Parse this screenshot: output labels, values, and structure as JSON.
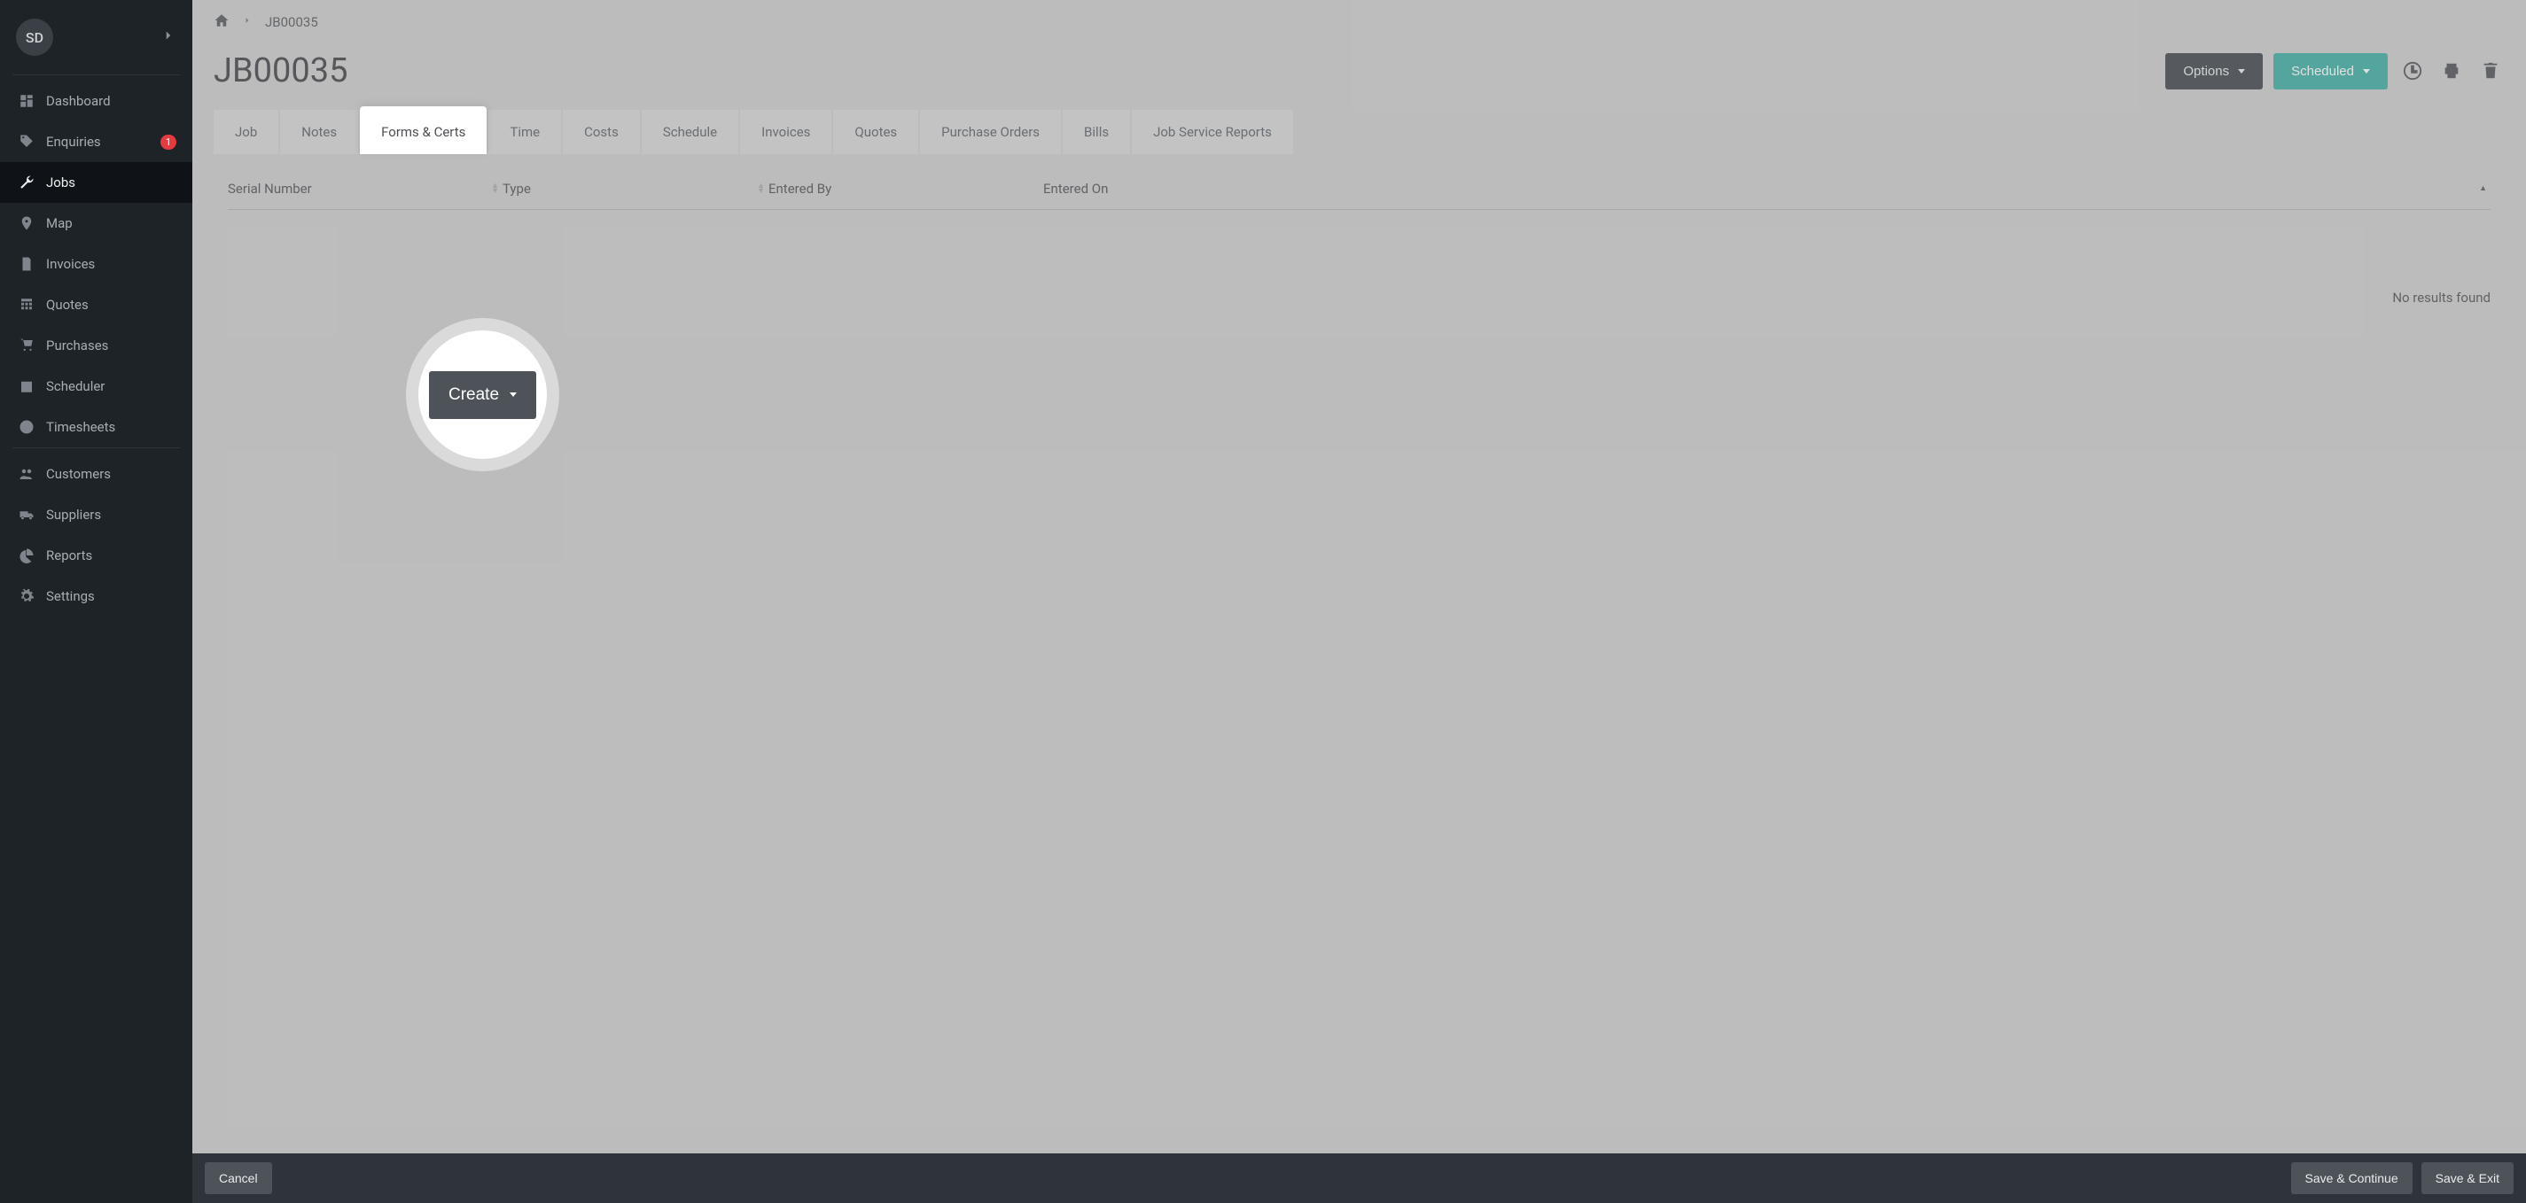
{
  "profile": {
    "initials": "SD"
  },
  "sidebar": {
    "items": [
      {
        "label": "Dashboard"
      },
      {
        "label": "Enquiries",
        "badge": "1"
      },
      {
        "label": "Jobs"
      },
      {
        "label": "Map"
      },
      {
        "label": "Invoices"
      },
      {
        "label": "Quotes"
      },
      {
        "label": "Purchases"
      },
      {
        "label": "Scheduler"
      },
      {
        "label": "Timesheets"
      },
      {
        "label": "Customers"
      },
      {
        "label": "Suppliers"
      },
      {
        "label": "Reports"
      },
      {
        "label": "Settings"
      }
    ]
  },
  "breadcrumbs": {
    "current": "JB00035"
  },
  "header": {
    "title": "JB00035",
    "options_label": "Options",
    "status_label": "Scheduled"
  },
  "tabs": [
    {
      "label": "Job"
    },
    {
      "label": "Notes"
    },
    {
      "label": "Forms & Certs"
    },
    {
      "label": "Time"
    },
    {
      "label": "Costs"
    },
    {
      "label": "Schedule"
    },
    {
      "label": "Invoices"
    },
    {
      "label": "Quotes"
    },
    {
      "label": "Purchase Orders"
    },
    {
      "label": "Bills"
    },
    {
      "label": "Job Service Reports"
    }
  ],
  "table": {
    "columns": {
      "serial": "Serial Number",
      "type": "Type",
      "by": "Entered By",
      "on": "Entered On"
    },
    "empty_text": "No results found"
  },
  "create": {
    "label": "Create"
  },
  "footer": {
    "cancel": "Cancel",
    "save_continue": "Save & Continue",
    "save_exit": "Save & Exit"
  }
}
